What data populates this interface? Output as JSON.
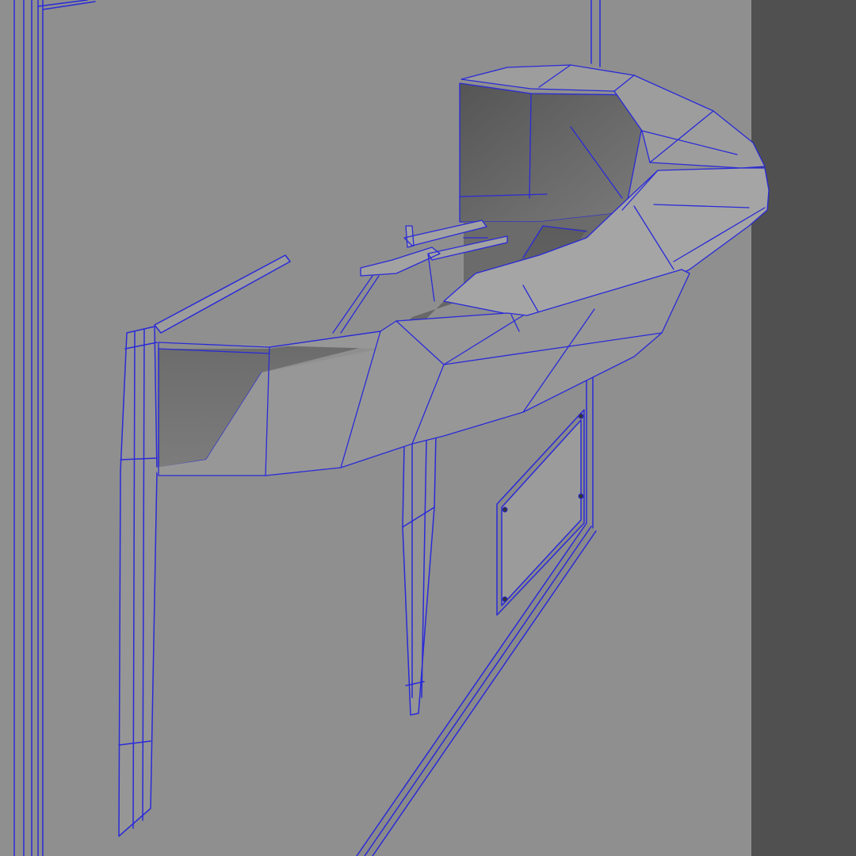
{
  "scene": {
    "kind": "wireframe-render",
    "subject": "wall-mounted-mailbox-model",
    "colors": {
      "background": "#8b8b8b",
      "wall_front": "#8f8f8f",
      "wall_side": "#505050",
      "cavity_dark": "#5a5a5a",
      "cavity_mid": "#6e6e6e",
      "surface_light": "#9a9a9a",
      "wire": "#2a2ad8",
      "wire_light": "#4a5ae0"
    }
  }
}
